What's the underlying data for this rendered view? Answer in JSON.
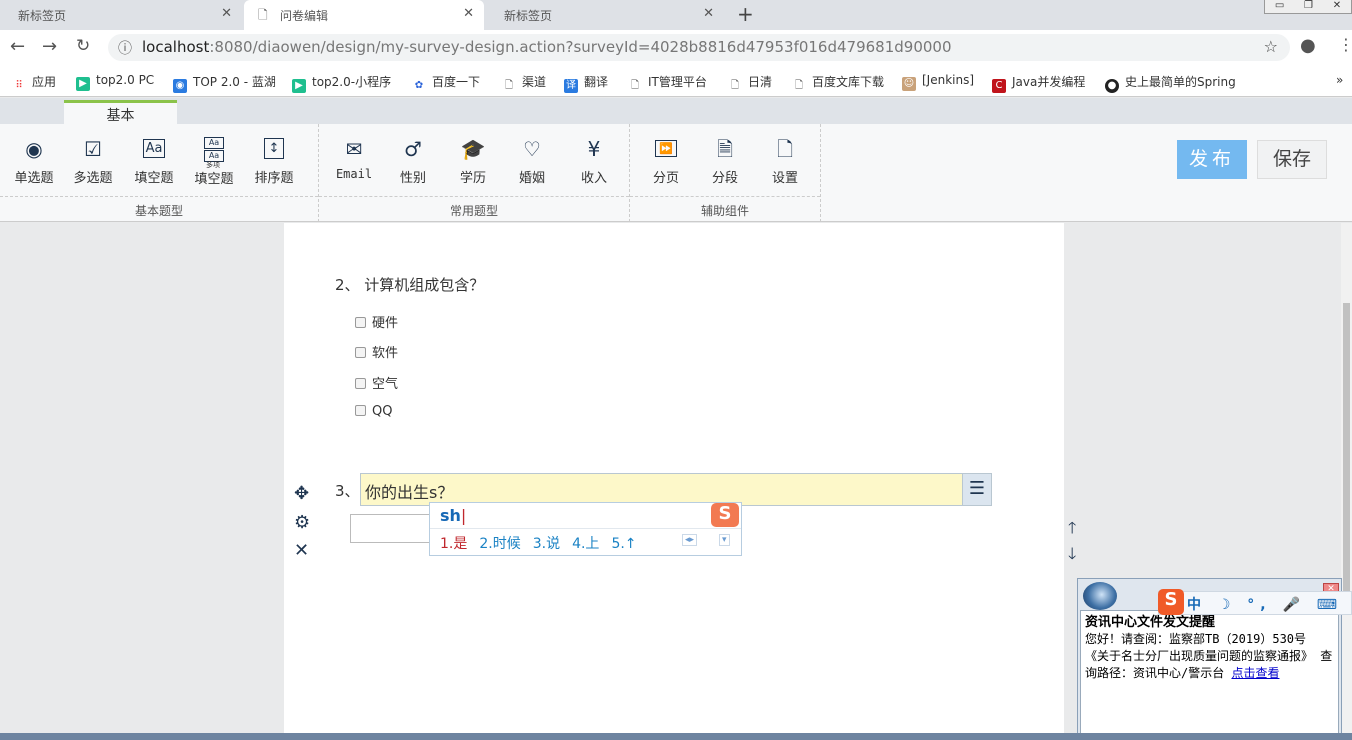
{
  "browser": {
    "tabs": [
      {
        "title": "新标签页"
      },
      {
        "title": "问卷编辑"
      },
      {
        "title": "新标签页"
      }
    ],
    "url_host": "localhost",
    "url_rest": ":8080/diaowen/design/my-survey-design.action?surveyId=4028b8816d47953f016d479681d90000",
    "bookmarks": [
      "应用",
      "top2.0 PC",
      "TOP 2.0 - 蓝湖",
      "top2.0-小程序",
      "百度一下",
      "渠道",
      "翻译",
      "IT管理平台",
      "日清",
      "百度文库下载",
      "[Jenkins]",
      "Java并发编程",
      "史上最简单的Spring"
    ]
  },
  "ribbon": {
    "tab": "基本",
    "groups": [
      {
        "caption": "基本题型",
        "tools": [
          {
            "label": "单选题",
            "icon": "radio-icon"
          },
          {
            "label": "多选题",
            "icon": "checkbox-icon"
          },
          {
            "label": "填空题",
            "icon": "text-icon"
          },
          {
            "label": "填空题",
            "sup": "多项",
            "icon": "multi-text-icon"
          },
          {
            "label": "排序题",
            "icon": "sort-icon"
          }
        ]
      },
      {
        "caption": "常用题型",
        "tools": [
          {
            "label": "Email",
            "icon": "mail-icon"
          },
          {
            "label": "性别",
            "icon": "male-icon"
          },
          {
            "label": "学历",
            "icon": "graduation-cap-icon"
          },
          {
            "label": "婚姻",
            "icon": "heart-icon"
          },
          {
            "label": "收入",
            "icon": "yen-icon"
          }
        ]
      },
      {
        "caption": "辅助组件",
        "tools": [
          {
            "label": "分页",
            "icon": "page-break-icon"
          },
          {
            "label": "分段",
            "icon": "paragraph-icon"
          },
          {
            "label": "设置",
            "icon": "settings-doc-icon"
          }
        ]
      }
    ],
    "publish": "发布",
    "save": "保存"
  },
  "survey": {
    "q2": {
      "title": "2、 计算机组成包含？",
      "options": [
        "硬件",
        "软件",
        "空气",
        "QQ"
      ]
    },
    "q3": {
      "number": "3、",
      "text": "你的出生s？"
    }
  },
  "ime": {
    "input": "sh",
    "candidates": [
      "1.是",
      "2.时候",
      "3.说",
      "4.上",
      "5.↑"
    ],
    "status": "中 ☽ °, 🎤 ⌨"
  },
  "notification": {
    "title": "资讯中心文件发文提醒",
    "body": "您好！请查阅：监察部TB（2019）530号 《关于名士分厂出现质量问题的监察通报》 查询路径：资讯中心/警示台 ",
    "link": "点击查看"
  }
}
